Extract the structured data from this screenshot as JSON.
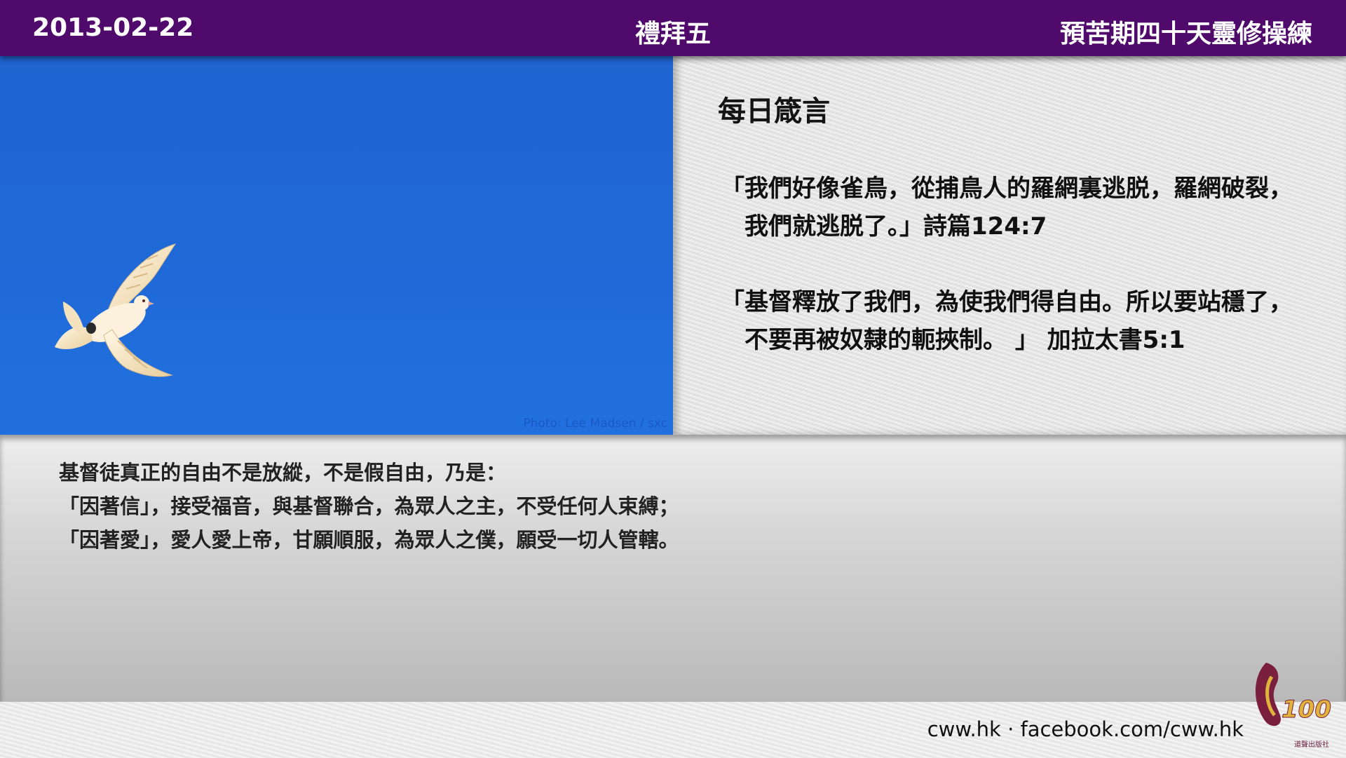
{
  "header": {
    "date": "2013-02-22",
    "weekday": "禮拜五",
    "series": "預苦期四十天靈修操練"
  },
  "photo": {
    "credit": "Photo: Lee Madsen / sxc",
    "subject": "dove-icon"
  },
  "verses": {
    "heading": "每日箴言",
    "items": [
      {
        "line1": "「我們好像雀鳥，從捕鳥人的羅網裏逃脱，羅網破裂，",
        "line2": "我們就逃脱了。」詩篇124:7"
      },
      {
        "line1": "「基督釋放了我們，為使我們得自由。所以要站穩了，",
        "line2": "不要再被奴隸的軛挾制。 」 加拉太書5:1"
      }
    ]
  },
  "reflection": {
    "lines": [
      "基督徒真正的自由不是放縱，不是假自由，乃是：",
      "「因著信」，接受福音，與基督聯合，為眾人之主，不受任何人束縛；",
      "「因著愛」，愛人愛上帝，甘願順服，為眾人之僕，願受一切人管轄。"
    ]
  },
  "footer": {
    "links": "cww.hk · facebook.com/cww.hk",
    "publisher": "道聲出版社",
    "logo_text": "100"
  },
  "colors": {
    "header_bg": "#4f0a6b",
    "sky": "#1f6ad8",
    "logo": "#e0b43a"
  }
}
